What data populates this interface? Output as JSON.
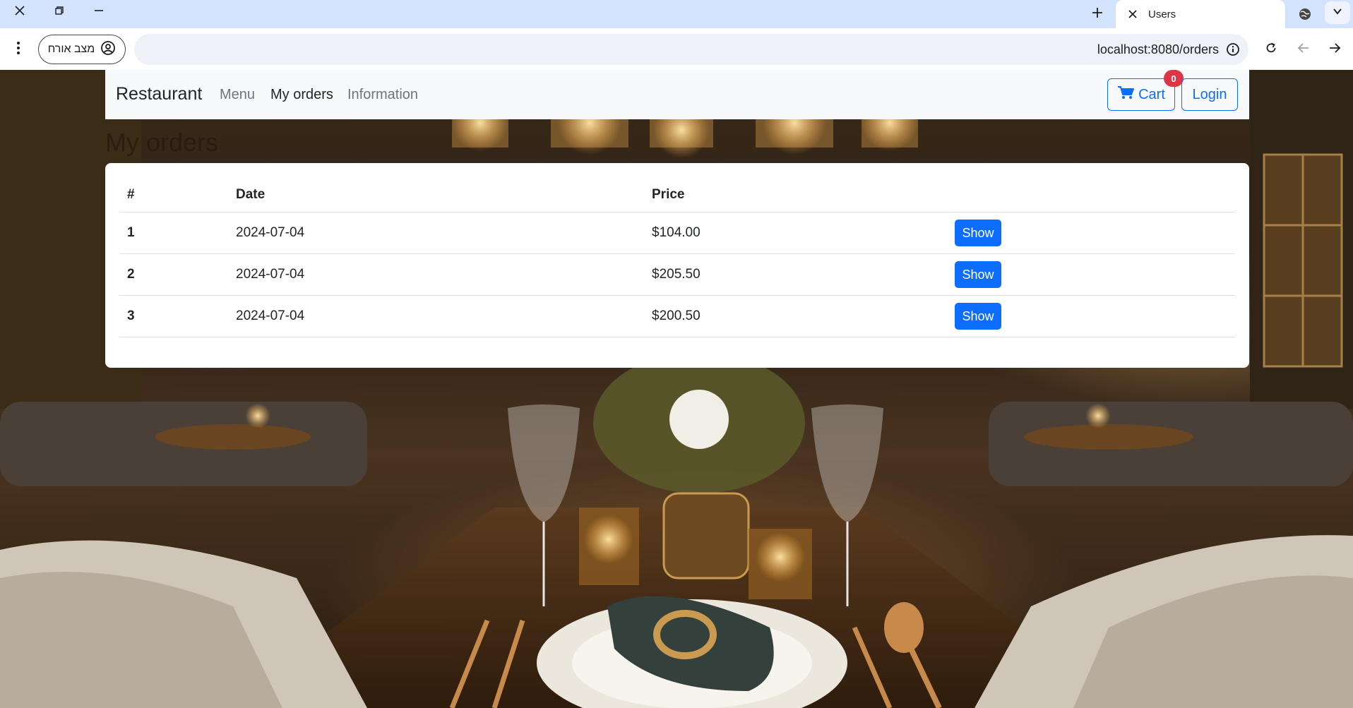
{
  "browser": {
    "tab_title": "Users",
    "url": "localhost:8080/orders",
    "guest_label": "מצב אורח"
  },
  "navbar": {
    "brand": "Restaurant",
    "links": [
      {
        "label": "Menu",
        "active": false
      },
      {
        "label": "My orders",
        "active": true
      },
      {
        "label": "Information",
        "active": false
      }
    ],
    "cart_label": "Cart",
    "cart_count": "0",
    "login_label": "Login"
  },
  "page": {
    "heading": "My orders"
  },
  "orders_table": {
    "headers": [
      "#",
      "Date",
      "Price",
      ""
    ],
    "rows": [
      {
        "num": "1",
        "date": "2024-07-04",
        "price": "$104.00",
        "action": "Show"
      },
      {
        "num": "2",
        "date": "2024-07-04",
        "price": "$205.50",
        "action": "Show"
      },
      {
        "num": "3",
        "date": "2024-07-04",
        "price": "$200.50",
        "action": "Show"
      }
    ]
  },
  "colors": {
    "primary": "#0d6efd",
    "badge": "#dc3545",
    "navbar_bg": "#f8f9fa",
    "tabbar_bg": "#d3e3fd"
  },
  "icons": [
    "close-icon",
    "restore-icon",
    "minimize-icon",
    "plus-icon",
    "globe-icon",
    "chevron-down-icon",
    "kebab-menu-icon",
    "profile-icon",
    "info-icon",
    "reload-icon",
    "back-arrow-icon",
    "forward-arrow-icon",
    "cart-icon"
  ]
}
